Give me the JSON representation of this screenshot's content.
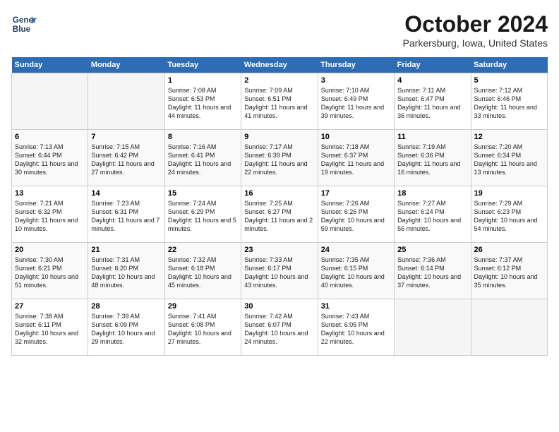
{
  "header": {
    "logo_line1": "General",
    "logo_line2": "Blue",
    "month": "October 2024",
    "location": "Parkersburg, Iowa, United States"
  },
  "days_of_week": [
    "Sunday",
    "Monday",
    "Tuesday",
    "Wednesday",
    "Thursday",
    "Friday",
    "Saturday"
  ],
  "weeks": [
    [
      {
        "day": "",
        "sunrise": "",
        "sunset": "",
        "daylight": "",
        "empty": true
      },
      {
        "day": "",
        "sunrise": "",
        "sunset": "",
        "daylight": "",
        "empty": true
      },
      {
        "day": "1",
        "sunrise": "Sunrise: 7:08 AM",
        "sunset": "Sunset: 6:53 PM",
        "daylight": "Daylight: 11 hours and 44 minutes.",
        "empty": false
      },
      {
        "day": "2",
        "sunrise": "Sunrise: 7:09 AM",
        "sunset": "Sunset: 6:51 PM",
        "daylight": "Daylight: 11 hours and 41 minutes.",
        "empty": false
      },
      {
        "day": "3",
        "sunrise": "Sunrise: 7:10 AM",
        "sunset": "Sunset: 6:49 PM",
        "daylight": "Daylight: 11 hours and 39 minutes.",
        "empty": false
      },
      {
        "day": "4",
        "sunrise": "Sunrise: 7:11 AM",
        "sunset": "Sunset: 6:47 PM",
        "daylight": "Daylight: 11 hours and 36 minutes.",
        "empty": false
      },
      {
        "day": "5",
        "sunrise": "Sunrise: 7:12 AM",
        "sunset": "Sunset: 6:46 PM",
        "daylight": "Daylight: 11 hours and 33 minutes.",
        "empty": false
      }
    ],
    [
      {
        "day": "6",
        "sunrise": "Sunrise: 7:13 AM",
        "sunset": "Sunset: 6:44 PM",
        "daylight": "Daylight: 11 hours and 30 minutes.",
        "empty": false
      },
      {
        "day": "7",
        "sunrise": "Sunrise: 7:15 AM",
        "sunset": "Sunset: 6:42 PM",
        "daylight": "Daylight: 11 hours and 27 minutes.",
        "empty": false
      },
      {
        "day": "8",
        "sunrise": "Sunrise: 7:16 AM",
        "sunset": "Sunset: 6:41 PM",
        "daylight": "Daylight: 11 hours and 24 minutes.",
        "empty": false
      },
      {
        "day": "9",
        "sunrise": "Sunrise: 7:17 AM",
        "sunset": "Sunset: 6:39 PM",
        "daylight": "Daylight: 11 hours and 22 minutes.",
        "empty": false
      },
      {
        "day": "10",
        "sunrise": "Sunrise: 7:18 AM",
        "sunset": "Sunset: 6:37 PM",
        "daylight": "Daylight: 11 hours and 19 minutes.",
        "empty": false
      },
      {
        "day": "11",
        "sunrise": "Sunrise: 7:19 AM",
        "sunset": "Sunset: 6:36 PM",
        "daylight": "Daylight: 11 hours and 16 minutes.",
        "empty": false
      },
      {
        "day": "12",
        "sunrise": "Sunrise: 7:20 AM",
        "sunset": "Sunset: 6:34 PM",
        "daylight": "Daylight: 11 hours and 13 minutes.",
        "empty": false
      }
    ],
    [
      {
        "day": "13",
        "sunrise": "Sunrise: 7:21 AM",
        "sunset": "Sunset: 6:32 PM",
        "daylight": "Daylight: 11 hours and 10 minutes.",
        "empty": false
      },
      {
        "day": "14",
        "sunrise": "Sunrise: 7:23 AM",
        "sunset": "Sunset: 6:31 PM",
        "daylight": "Daylight: 11 hours and 7 minutes.",
        "empty": false
      },
      {
        "day": "15",
        "sunrise": "Sunrise: 7:24 AM",
        "sunset": "Sunset: 6:29 PM",
        "daylight": "Daylight: 11 hours and 5 minutes.",
        "empty": false
      },
      {
        "day": "16",
        "sunrise": "Sunrise: 7:25 AM",
        "sunset": "Sunset: 6:27 PM",
        "daylight": "Daylight: 11 hours and 2 minutes.",
        "empty": false
      },
      {
        "day": "17",
        "sunrise": "Sunrise: 7:26 AM",
        "sunset": "Sunset: 6:26 PM",
        "daylight": "Daylight: 10 hours and 59 minutes.",
        "empty": false
      },
      {
        "day": "18",
        "sunrise": "Sunrise: 7:27 AM",
        "sunset": "Sunset: 6:24 PM",
        "daylight": "Daylight: 10 hours and 56 minutes.",
        "empty": false
      },
      {
        "day": "19",
        "sunrise": "Sunrise: 7:29 AM",
        "sunset": "Sunset: 6:23 PM",
        "daylight": "Daylight: 10 hours and 54 minutes.",
        "empty": false
      }
    ],
    [
      {
        "day": "20",
        "sunrise": "Sunrise: 7:30 AM",
        "sunset": "Sunset: 6:21 PM",
        "daylight": "Daylight: 10 hours and 51 minutes.",
        "empty": false
      },
      {
        "day": "21",
        "sunrise": "Sunrise: 7:31 AM",
        "sunset": "Sunset: 6:20 PM",
        "daylight": "Daylight: 10 hours and 48 minutes.",
        "empty": false
      },
      {
        "day": "22",
        "sunrise": "Sunrise: 7:32 AM",
        "sunset": "Sunset: 6:18 PM",
        "daylight": "Daylight: 10 hours and 45 minutes.",
        "empty": false
      },
      {
        "day": "23",
        "sunrise": "Sunrise: 7:33 AM",
        "sunset": "Sunset: 6:17 PM",
        "daylight": "Daylight: 10 hours and 43 minutes.",
        "empty": false
      },
      {
        "day": "24",
        "sunrise": "Sunrise: 7:35 AM",
        "sunset": "Sunset: 6:15 PM",
        "daylight": "Daylight: 10 hours and 40 minutes.",
        "empty": false
      },
      {
        "day": "25",
        "sunrise": "Sunrise: 7:36 AM",
        "sunset": "Sunset: 6:14 PM",
        "daylight": "Daylight: 10 hours and 37 minutes.",
        "empty": false
      },
      {
        "day": "26",
        "sunrise": "Sunrise: 7:37 AM",
        "sunset": "Sunset: 6:12 PM",
        "daylight": "Daylight: 10 hours and 35 minutes.",
        "empty": false
      }
    ],
    [
      {
        "day": "27",
        "sunrise": "Sunrise: 7:38 AM",
        "sunset": "Sunset: 6:11 PM",
        "daylight": "Daylight: 10 hours and 32 minutes.",
        "empty": false
      },
      {
        "day": "28",
        "sunrise": "Sunrise: 7:39 AM",
        "sunset": "Sunset: 6:09 PM",
        "daylight": "Daylight: 10 hours and 29 minutes.",
        "empty": false
      },
      {
        "day": "29",
        "sunrise": "Sunrise: 7:41 AM",
        "sunset": "Sunset: 6:08 PM",
        "daylight": "Daylight: 10 hours and 27 minutes.",
        "empty": false
      },
      {
        "day": "30",
        "sunrise": "Sunrise: 7:42 AM",
        "sunset": "Sunset: 6:07 PM",
        "daylight": "Daylight: 10 hours and 24 minutes.",
        "empty": false
      },
      {
        "day": "31",
        "sunrise": "Sunrise: 7:43 AM",
        "sunset": "Sunset: 6:05 PM",
        "daylight": "Daylight: 10 hours and 22 minutes.",
        "empty": false
      },
      {
        "day": "",
        "sunrise": "",
        "sunset": "",
        "daylight": "",
        "empty": true
      },
      {
        "day": "",
        "sunrise": "",
        "sunset": "",
        "daylight": "",
        "empty": true
      }
    ]
  ]
}
